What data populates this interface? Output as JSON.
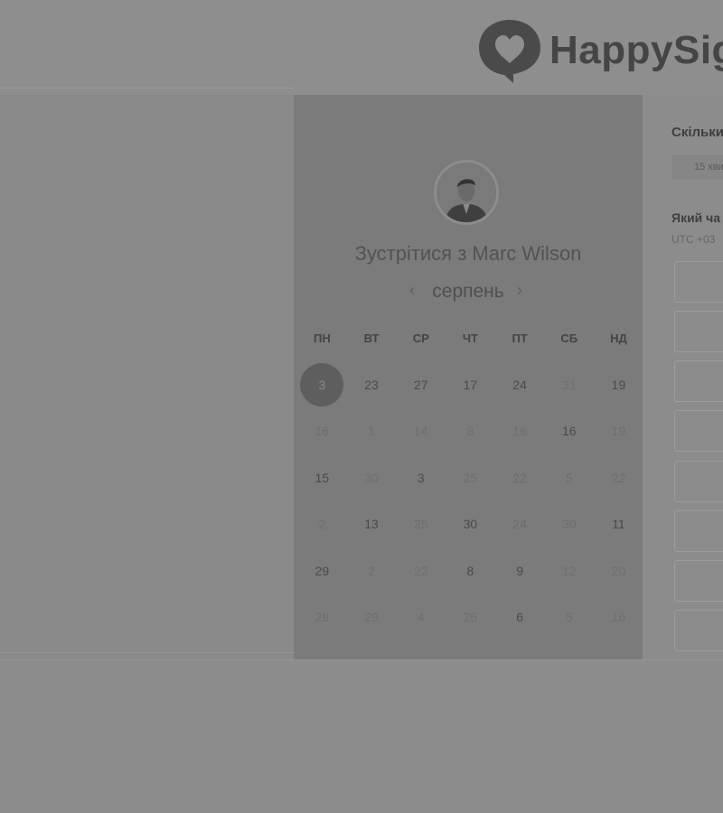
{
  "brand": {
    "name": "HappySig"
  },
  "calendar": {
    "title": "Зустрітися з Marc Wilson",
    "month": "серпень",
    "prev_icon": "‹",
    "next_icon": "›",
    "weekdays": [
      "ПН",
      "ВТ",
      "СР",
      "ЧТ",
      "ПТ",
      "СБ",
      "НД"
    ],
    "selected_day": "3",
    "days": [
      {
        "label": "3",
        "muted": false,
        "selected": true
      },
      {
        "label": "23",
        "muted": false
      },
      {
        "label": "27",
        "muted": false
      },
      {
        "label": "17",
        "muted": false
      },
      {
        "label": "24",
        "muted": false
      },
      {
        "label": "31",
        "muted": true
      },
      {
        "label": "19",
        "muted": false
      },
      {
        "label": "16",
        "muted": true
      },
      {
        "label": "1",
        "muted": true
      },
      {
        "label": "14",
        "muted": true
      },
      {
        "label": "8",
        "muted": true
      },
      {
        "label": "16",
        "muted": true
      },
      {
        "label": "16",
        "muted": false
      },
      {
        "label": "19",
        "muted": true
      },
      {
        "label": "15",
        "muted": false
      },
      {
        "label": "30",
        "muted": true
      },
      {
        "label": "3",
        "muted": false
      },
      {
        "label": "25",
        "muted": true
      },
      {
        "label": "22",
        "muted": true
      },
      {
        "label": "5",
        "muted": true
      },
      {
        "label": "22",
        "muted": true
      },
      {
        "label": "2",
        "muted": true
      },
      {
        "label": "13",
        "muted": false
      },
      {
        "label": "25",
        "muted": true
      },
      {
        "label": "30",
        "muted": false
      },
      {
        "label": "24",
        "muted": true
      },
      {
        "label": "30",
        "muted": true
      },
      {
        "label": "11",
        "muted": false
      },
      {
        "label": "29",
        "muted": false
      },
      {
        "label": "2",
        "muted": true
      },
      {
        "label": "22",
        "muted": true
      },
      {
        "label": "8",
        "muted": false
      },
      {
        "label": "9",
        "muted": false
      },
      {
        "label": "12",
        "muted": true
      },
      {
        "label": "20",
        "muted": true
      },
      {
        "label": "29",
        "muted": true
      },
      {
        "label": "29",
        "muted": true
      },
      {
        "label": "4",
        "muted": true
      },
      {
        "label": "26",
        "muted": true
      },
      {
        "label": "6",
        "muted": false
      },
      {
        "label": "5",
        "muted": true
      },
      {
        "label": "16",
        "muted": true
      }
    ]
  },
  "booking": {
    "duration_heading": "Скільки",
    "duration_value": "15 хви",
    "time_heading": "Який ча",
    "timezone": "UTC +03"
  }
}
